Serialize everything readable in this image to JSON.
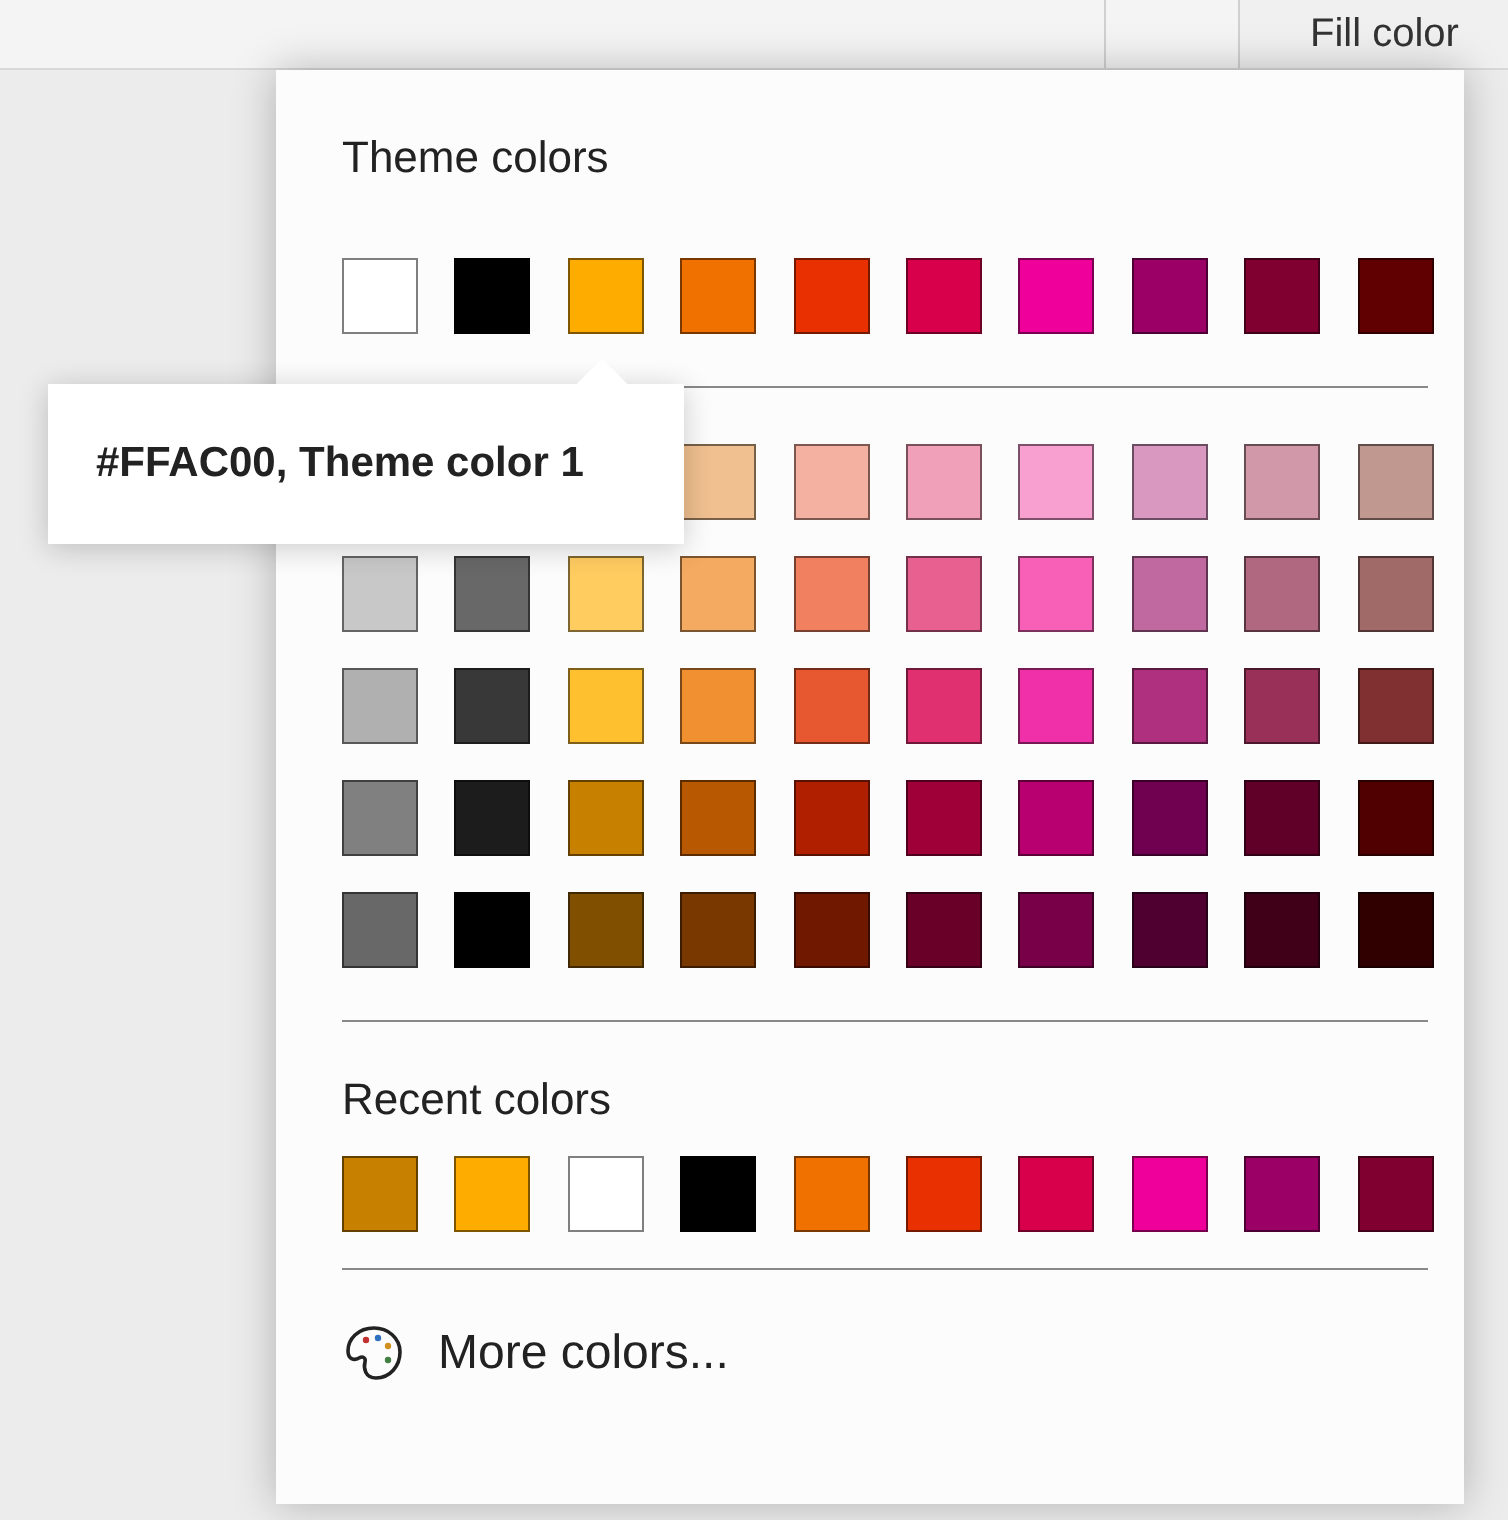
{
  "header": {
    "label": "Fill color"
  },
  "theme_colors": {
    "title": "Theme colors",
    "swatches": [
      {
        "color": "#ffffff"
      },
      {
        "color": "#000000"
      },
      {
        "color": "#ffac00"
      },
      {
        "color": "#f07000"
      },
      {
        "color": "#e83000"
      },
      {
        "color": "#d8004a"
      },
      {
        "color": "#f0009a"
      },
      {
        "color": "#9a0066"
      },
      {
        "color": "#800030"
      },
      {
        "color": "#600000"
      }
    ],
    "shades": [
      [
        {
          "color": "#f0c090"
        },
        {
          "color": "#f4b0a0"
        },
        {
          "color": "#f0a0b8"
        },
        {
          "color": "#f8a0d0"
        },
        {
          "color": "#d898c0"
        },
        {
          "color": "#d098a8"
        },
        {
          "color": "#c09890"
        }
      ],
      [
        {
          "color": "#c8c8c8"
        },
        {
          "color": "#686868"
        },
        {
          "color": "#ffcc60"
        },
        {
          "color": "#f4aa60"
        },
        {
          "color": "#f08060"
        },
        {
          "color": "#e86090"
        },
        {
          "color": "#f860b8"
        },
        {
          "color": "#c068a0"
        },
        {
          "color": "#b06880"
        },
        {
          "color": "#a06a68"
        }
      ],
      [
        {
          "color": "#b0b0b0"
        },
        {
          "color": "#383838"
        },
        {
          "color": "#ffc030"
        },
        {
          "color": "#f09030"
        },
        {
          "color": "#e85830"
        },
        {
          "color": "#e03070"
        },
        {
          "color": "#f030a8"
        },
        {
          "color": "#b03080"
        },
        {
          "color": "#983058"
        },
        {
          "color": "#803030"
        }
      ],
      [
        {
          "color": "#808080"
        },
        {
          "color": "#1c1c1c"
        },
        {
          "color": "#c88000"
        },
        {
          "color": "#b85800"
        },
        {
          "color": "#b02000"
        },
        {
          "color": "#a00038"
        },
        {
          "color": "#b80070"
        },
        {
          "color": "#700050"
        },
        {
          "color": "#600028"
        },
        {
          "color": "#500000"
        }
      ],
      [
        {
          "color": "#686868"
        },
        {
          "color": "#000000"
        },
        {
          "color": "#805000"
        },
        {
          "color": "#783800"
        },
        {
          "color": "#701800"
        },
        {
          "color": "#680028"
        },
        {
          "color": "#780048"
        },
        {
          "color": "#500030"
        },
        {
          "color": "#400018"
        },
        {
          "color": "#300000"
        }
      ]
    ]
  },
  "tooltip": {
    "text": "#FFAC00, Theme color 1"
  },
  "recent_colors": {
    "title": "Recent colors",
    "swatches": [
      {
        "color": "#c88000"
      },
      {
        "color": "#ffac00"
      },
      {
        "color": "#ffffff"
      },
      {
        "color": "#000000"
      },
      {
        "color": "#f07000"
      },
      {
        "color": "#e83000"
      },
      {
        "color": "#d8004a"
      },
      {
        "color": "#f0009a"
      },
      {
        "color": "#9a0066"
      },
      {
        "color": "#800030"
      }
    ]
  },
  "more_colors": {
    "label": "More colors..."
  }
}
